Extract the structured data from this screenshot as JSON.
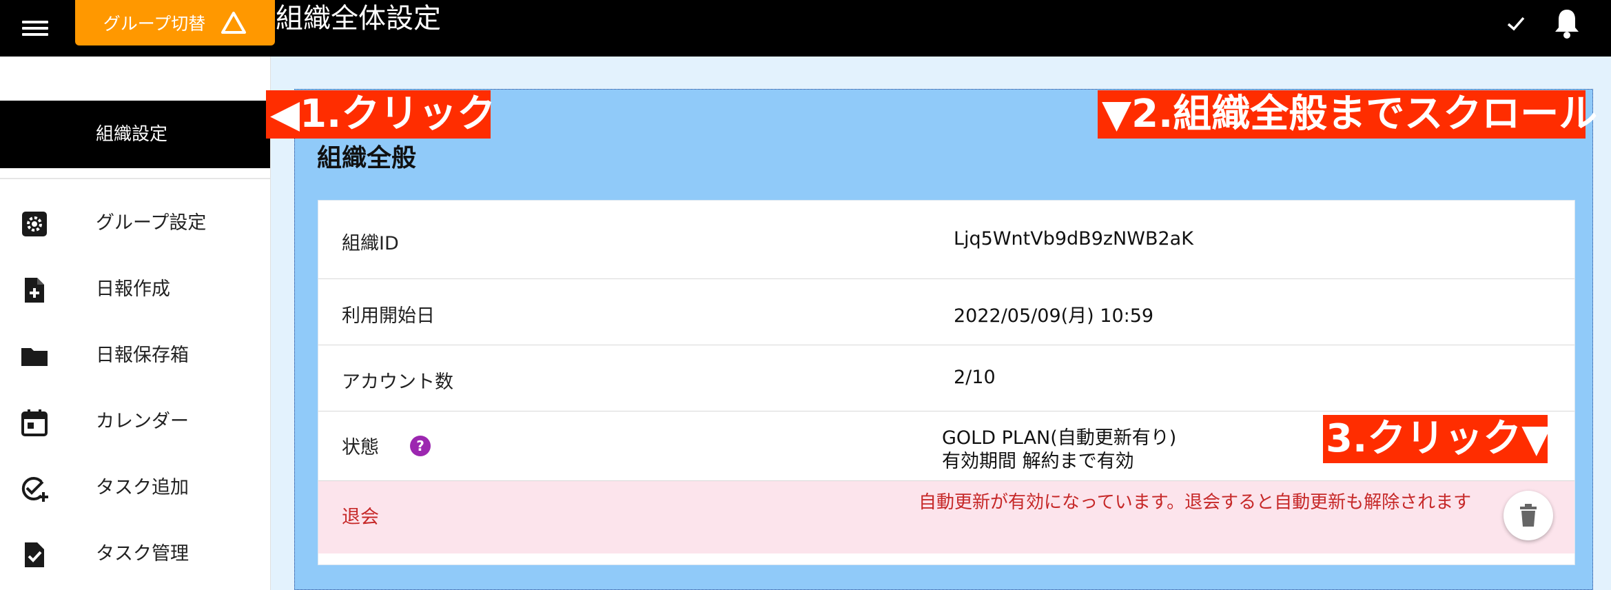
{
  "header": {
    "group_switch_label": "グループ切替",
    "title": "組織全体設定",
    "icons": [
      "menu-icon",
      "warning-icon",
      "check-icon",
      "bell-icon"
    ]
  },
  "sidebar": {
    "active_item": "組織設定",
    "items": [
      {
        "label": "グループ設定",
        "icon": "gear-icon"
      },
      {
        "label": "日報作成",
        "icon": "file-add-icon"
      },
      {
        "label": "日報保存箱",
        "icon": "folder-icon"
      },
      {
        "label": "カレンダー",
        "icon": "calendar-icon"
      },
      {
        "label": "タスク追加",
        "icon": "task-add-icon"
      },
      {
        "label": "タスク管理",
        "icon": "task-check-icon"
      }
    ]
  },
  "section": {
    "title": "組織全般",
    "rows": [
      {
        "label": "組織ID",
        "value": "Ljq5WntVb9dB9zNWB2aK"
      },
      {
        "label": "利用開始日",
        "value": "2022/05/09(月) 10:59"
      },
      {
        "label": "アカウント数",
        "value": "2/10"
      }
    ],
    "status": {
      "label": "状態",
      "help_glyph": "?",
      "plan": "GOLD PLAN(自動更新有り)",
      "validity": "有効期間 解約まで有効"
    },
    "withdraw": {
      "label": "退会",
      "message": "自動更新が有効になっています。退会すると自動更新も解除されます"
    }
  },
  "annotations": {
    "step1": "◀1.クリック",
    "step2": "▼2.組織全般までスクロール",
    "step3": "3.クリック▼"
  },
  "colors": {
    "accent_orange": "#ff9800",
    "section_blue": "#90caf9",
    "danger_red": "#c62828",
    "withdraw_bg": "#fce4ec",
    "callout_red": "#ff2d00",
    "help_purple": "#9c27b0"
  }
}
